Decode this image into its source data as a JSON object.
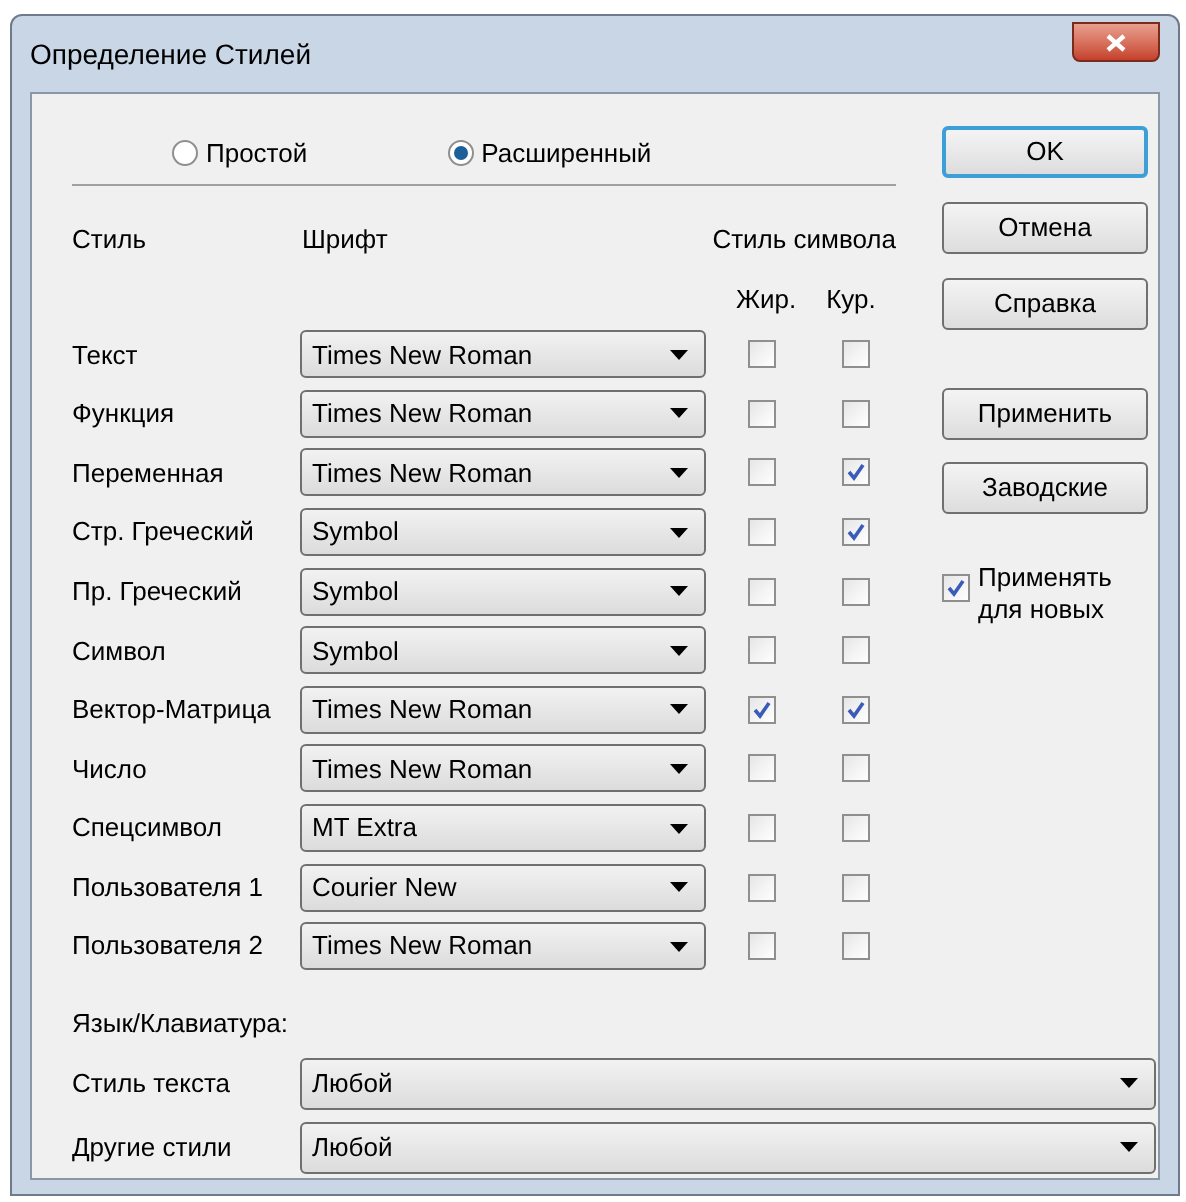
{
  "window": {
    "title": "Определение Стилей"
  },
  "mode_options": [
    {
      "label": "Простой",
      "selected": false
    },
    {
      "label": "Расширенный",
      "selected": true
    }
  ],
  "columns": {
    "style": "Стиль",
    "font": "Шрифт",
    "char_style": "Стиль символа",
    "bold": "Жир.",
    "italic": "Кур."
  },
  "styles": [
    {
      "name": "Текст",
      "font": "Times New Roman",
      "bold": false,
      "italic": false
    },
    {
      "name": "Функция",
      "font": "Times New Roman",
      "bold": false,
      "italic": false
    },
    {
      "name": "Переменная",
      "font": "Times New Roman",
      "bold": false,
      "italic": true
    },
    {
      "name": "Стр. Греческий",
      "font": "Symbol",
      "bold": false,
      "italic": true
    },
    {
      "name": "Пр. Греческий",
      "font": "Symbol",
      "bold": false,
      "italic": false
    },
    {
      "name": "Символ",
      "font": "Symbol",
      "bold": false,
      "italic": false
    },
    {
      "name": "Вектор-Матрица",
      "font": "Times New Roman",
      "bold": true,
      "italic": true
    },
    {
      "name": "Число",
      "font": "Times New Roman",
      "bold": false,
      "italic": false
    },
    {
      "name": "Спецсимвол",
      "font": "MT Extra",
      "bold": false,
      "italic": false
    },
    {
      "name": "Пользователя 1",
      "font": "Courier New",
      "bold": false,
      "italic": false
    },
    {
      "name": "Пользователя 2",
      "font": "Times New Roman",
      "bold": false,
      "italic": false
    }
  ],
  "dialog_buttons": [
    {
      "label": "OK",
      "default": true
    },
    {
      "label": "Отмена",
      "default": false
    },
    {
      "label": "Справка",
      "default": false
    }
  ],
  "style_buttons": [
    {
      "label": "Применить"
    },
    {
      "label": "Заводские"
    }
  ],
  "apply_new": {
    "label": "Применять для новых",
    "checked": true
  },
  "language": {
    "heading": "Язык/Клавиатура:",
    "fields": [
      {
        "label": "Стиль текста",
        "value": "Любой"
      },
      {
        "label": "Другие стили",
        "value": "Любой"
      }
    ]
  }
}
